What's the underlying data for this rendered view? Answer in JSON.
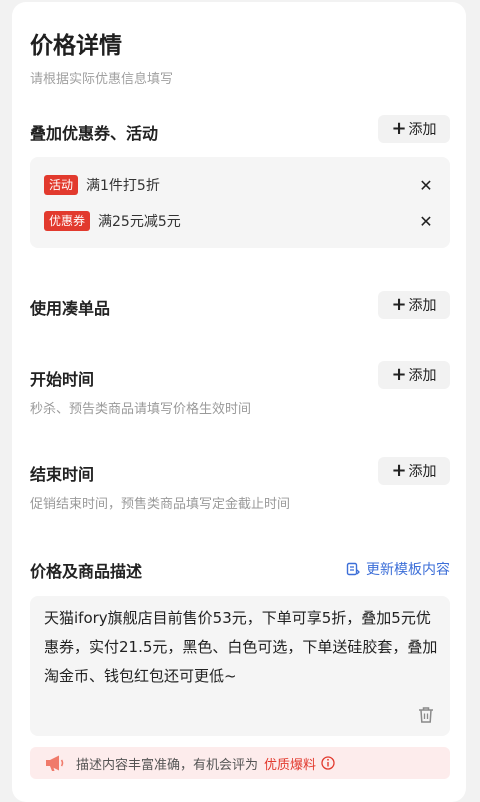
{
  "page": {
    "title": "价格详情",
    "subtitle": "请根据实际优惠信息填写"
  },
  "stacking": {
    "title": "叠加优惠券、活动",
    "add_label": "添加",
    "items": [
      {
        "tag": "活动",
        "text": "满1件打5折"
      },
      {
        "tag": "优惠券",
        "text": "满25元减5元"
      }
    ]
  },
  "bundle": {
    "title": "使用凑单品",
    "add_label": "添加"
  },
  "start_time": {
    "title": "开始时间",
    "hint": "秒杀、预告类商品请填写价格生效时间",
    "add_label": "添加"
  },
  "end_time": {
    "title": "结束时间",
    "hint": "促销结束时间，预售类商品填写定金截止时间",
    "add_label": "添加"
  },
  "description": {
    "title": "价格及商品描述",
    "update_label": "更新模板内容",
    "text": "天猫ifory旗舰店目前售价53元，下单可享5折，叠加5元优惠券，实付21.5元，黑色、白色可选，下单送硅胶套，叠加淘金币、钱包红包还可更低~"
  },
  "banner": {
    "text": "描述内容丰富准确，有机会评为",
    "highlight": "优质爆料"
  },
  "colors": {
    "accent_red": "#e23a2e",
    "link_blue": "#3d6fd8"
  }
}
